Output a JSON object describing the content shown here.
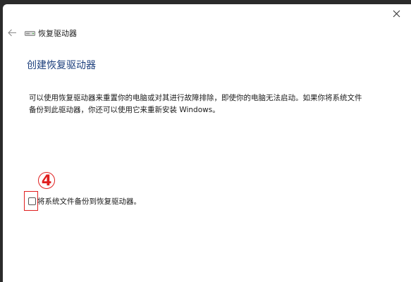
{
  "window": {
    "title": "恢复驱动器",
    "close_label": "✕",
    "back_label": "←"
  },
  "main": {
    "heading": "创建恢复驱动器",
    "description": "可以使用恢复驱动器来重置你的电脑或对其进行故障排除，即使你的电脑无法启动。如果你将系统文件备份到此驱动器，你还可以使用它来重新安装 Windows。",
    "checkbox": {
      "label": "将系统文件备份到恢复驱动器。",
      "checked": false
    }
  },
  "annotation": {
    "step_number": "4"
  },
  "colors": {
    "heading": "#1b3e7c",
    "annotation": "#e02020",
    "window_bg": "#ffffff",
    "desktop_bg": "#2b2b2b"
  },
  "icons": {
    "close": "close-icon",
    "back": "back-arrow-icon",
    "drive": "drive-icon"
  }
}
